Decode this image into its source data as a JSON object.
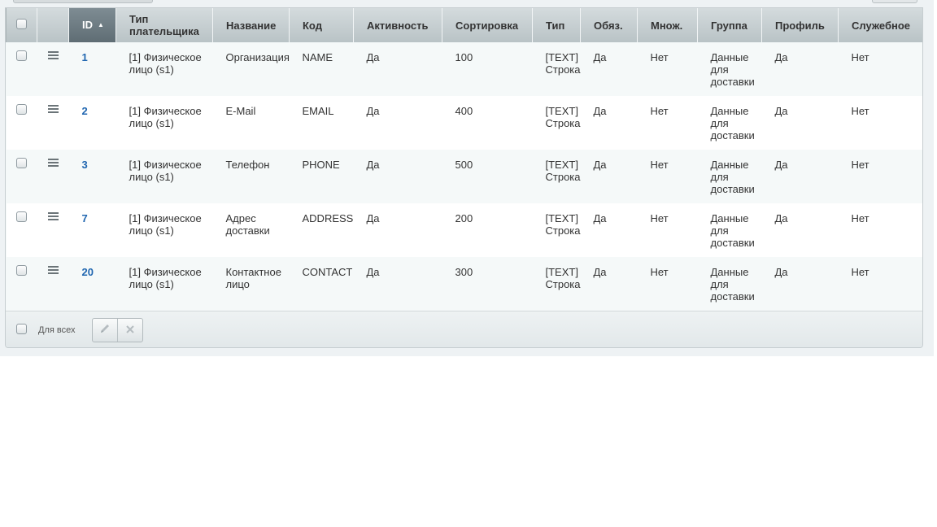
{
  "table": {
    "columns": [
      {
        "key": "checkbox",
        "label": ""
      },
      {
        "key": "actions",
        "label": ""
      },
      {
        "key": "id",
        "label": "ID",
        "sorted": "asc"
      },
      {
        "key": "payer_type",
        "label": "Тип плательщика"
      },
      {
        "key": "name",
        "label": "Название"
      },
      {
        "key": "code",
        "label": "Код"
      },
      {
        "key": "active",
        "label": "Активность"
      },
      {
        "key": "sort",
        "label": "Сортировка"
      },
      {
        "key": "type",
        "label": "Тип"
      },
      {
        "key": "required",
        "label": "Обяз."
      },
      {
        "key": "multiple",
        "label": "Множ."
      },
      {
        "key": "group",
        "label": "Группа"
      },
      {
        "key": "profile",
        "label": "Профиль"
      },
      {
        "key": "utility",
        "label": "Служебное"
      }
    ],
    "rows": [
      {
        "id": "1",
        "payer_type": "[1] Физическое лицо (s1)",
        "name": "Организация",
        "code": "NAME",
        "active": "Да",
        "sort": "100",
        "type": "[TEXT] Строка",
        "required": "Да",
        "multiple": "Нет",
        "group": "Данные для доставки",
        "profile": "Да",
        "utility": "Нет"
      },
      {
        "id": "2",
        "payer_type": "[1] Физическое лицо (s1)",
        "name": "E-Mail",
        "code": "EMAIL",
        "active": "Да",
        "sort": "400",
        "type": "[TEXT] Строка",
        "required": "Да",
        "multiple": "Нет",
        "group": "Данные для доставки",
        "profile": "Да",
        "utility": "Нет"
      },
      {
        "id": "3",
        "payer_type": "[1] Физическое лицо (s1)",
        "name": "Телефон",
        "code": "PHONE",
        "active": "Да",
        "sort": "500",
        "type": "[TEXT] Строка",
        "required": "Да",
        "multiple": "Нет",
        "group": "Данные для доставки",
        "profile": "Да",
        "utility": "Нет"
      },
      {
        "id": "7",
        "payer_type": "[1] Физическое лицо (s1)",
        "name": "Адрес доставки",
        "code": "ADDRESS",
        "active": "Да",
        "sort": "200",
        "type": "[TEXT] Строка",
        "required": "Да",
        "multiple": "Нет",
        "group": "Данные для доставки",
        "profile": "Да",
        "utility": "Нет"
      },
      {
        "id": "20",
        "payer_type": "[1] Физическое лицо (s1)",
        "name": "Контактное лицо",
        "code": "CONTACT",
        "active": "Да",
        "sort": "300",
        "type": "[TEXT] Строка",
        "required": "Да",
        "multiple": "Нет",
        "group": "Данные для доставки",
        "profile": "Да",
        "utility": "Нет"
      }
    ]
  },
  "footer": {
    "for_all_label": "Для всех",
    "actions": [
      {
        "name": "edit",
        "icon": "pencil-icon"
      },
      {
        "name": "delete",
        "icon": "x-icon"
      }
    ]
  },
  "colors": {
    "header_bg": "#c3cccf",
    "sorted_header_bg": "#6e7c83",
    "id_link": "#2066b0",
    "row_alt": "#f5f9f9"
  }
}
